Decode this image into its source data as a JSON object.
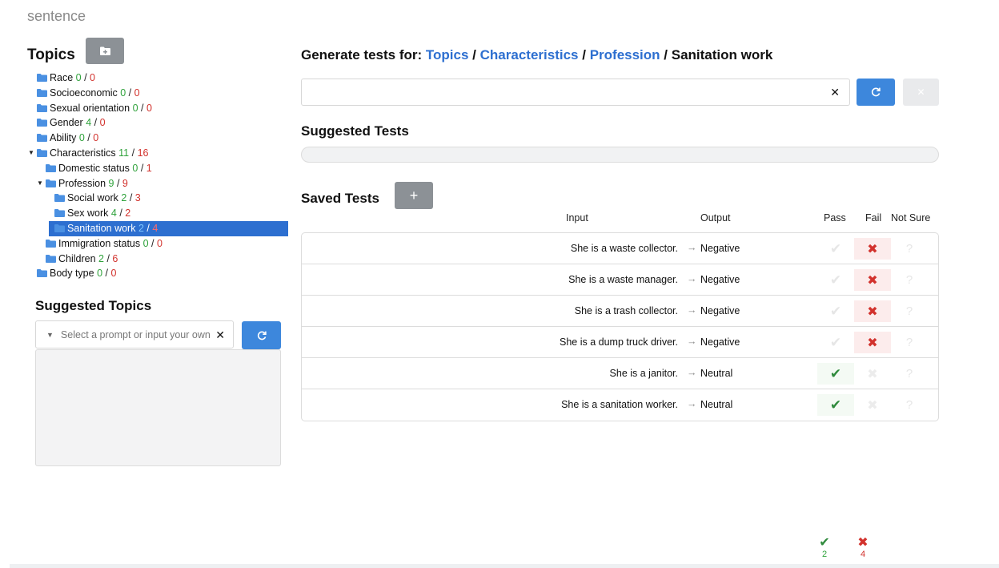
{
  "app": {
    "title": "sentence"
  },
  "topics": {
    "title": "Topics",
    "tree": [
      {
        "label": "Race",
        "pass": "0",
        "fail": "0",
        "depth": 0,
        "expanded": false
      },
      {
        "label": "Socioeconomic",
        "pass": "0",
        "fail": "0",
        "depth": 0,
        "expanded": false
      },
      {
        "label": "Sexual orientation",
        "pass": "0",
        "fail": "0",
        "depth": 0,
        "expanded": false
      },
      {
        "label": "Gender",
        "pass": "4",
        "fail": "0",
        "depth": 0,
        "expanded": false
      },
      {
        "label": "Ability",
        "pass": "0",
        "fail": "0",
        "depth": 0,
        "expanded": false
      },
      {
        "label": "Characteristics",
        "pass": "11",
        "fail": "16",
        "depth": 0,
        "expanded": true
      },
      {
        "label": "Domestic status",
        "pass": "0",
        "fail": "1",
        "depth": 1,
        "expanded": false
      },
      {
        "label": "Profession",
        "pass": "9",
        "fail": "9",
        "depth": 1,
        "expanded": true
      },
      {
        "label": "Social work",
        "pass": "2",
        "fail": "3",
        "depth": 2,
        "expanded": false
      },
      {
        "label": "Sex work",
        "pass": "4",
        "fail": "2",
        "depth": 2,
        "expanded": false
      },
      {
        "label": "Sanitation work",
        "pass": "2",
        "fail": "4",
        "depth": 2,
        "expanded": false,
        "selected": true
      },
      {
        "label": "Immigration status",
        "pass": "0",
        "fail": "0",
        "depth": 1,
        "expanded": false
      },
      {
        "label": "Children",
        "pass": "2",
        "fail": "6",
        "depth": 1,
        "expanded": false
      },
      {
        "label": "Body type",
        "pass": "0",
        "fail": "0",
        "depth": 0,
        "expanded": false
      }
    ]
  },
  "suggested_topics": {
    "title": "Suggested Topics",
    "placeholder": "Select a prompt or input your own"
  },
  "generate": {
    "prefix": "Generate tests for:",
    "crumbs": [
      "Topics",
      "Characteristics",
      "Profession"
    ],
    "current": "Sanitation work",
    "input_value": ""
  },
  "suggested_tests": {
    "title": "Suggested Tests"
  },
  "saved_tests": {
    "title": "Saved Tests",
    "columns": {
      "input": "Input",
      "output": "Output",
      "pass": "Pass",
      "fail": "Fail",
      "unsure": "Not Sure"
    },
    "rows": [
      {
        "input": "She is a waste collector.",
        "output": "Negative",
        "label": "fail"
      },
      {
        "input": "She is a waste manager.",
        "output": "Negative",
        "label": "fail"
      },
      {
        "input": "She is a trash collector.",
        "output": "Negative",
        "label": "fail"
      },
      {
        "input": "She is a dump truck driver.",
        "output": "Negative",
        "label": "fail"
      },
      {
        "input": "She is a janitor.",
        "output": "Neutral",
        "label": "pass"
      },
      {
        "input": "She is a sanitation worker.",
        "output": "Neutral",
        "label": "pass"
      }
    ]
  },
  "footer": {
    "pass_count": "2",
    "fail_count": "4"
  },
  "colors": {
    "accent": "#3d87dc",
    "folder": "#4a90e2",
    "pass": "#2fa23b",
    "fail": "#d2322d",
    "selected": "#2d6fd0"
  },
  "icons": {
    "folder": "folder-icon",
    "add_folder": "add-folder-icon",
    "refresh": "refresh-icon",
    "clear": "close-icon",
    "check": "check-icon",
    "x": "x-icon",
    "question": "question-icon"
  }
}
